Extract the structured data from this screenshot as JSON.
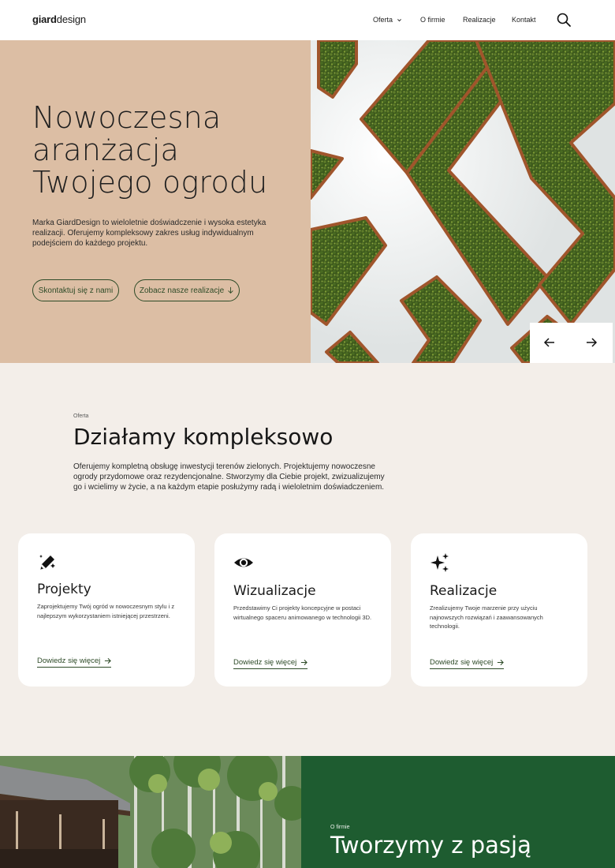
{
  "header": {
    "logo_bold": "giard",
    "logo_rest": "design",
    "nav": [
      "Oferta",
      "O firmie",
      "Realizacje",
      "Kontakt"
    ],
    "icons": {
      "dropdown": "chevron-down-icon",
      "search": "search-icon"
    }
  },
  "hero": {
    "title": "Nowoczesna aranżacja Twojego ogrodu",
    "text": "Marka GiardDesign to wieloletnie doświadczenie i wysoka estetyka realizacji. Oferujemy kompleksowy zakres usług indywidualnym podejściem do każdego projektu.",
    "btn_contact": "Skontaktuj się z nami",
    "btn_realizations": "Zobacz nasze realizacje",
    "image": "garden-maze-photo",
    "slider_icons": {
      "prev": "arrow-left-icon",
      "next": "arrow-right-icon"
    }
  },
  "offer": {
    "eyebrow": "Oferta",
    "title": "Działamy kompleksowo",
    "text": "Oferujemy kompletną obsługę inwestycji terenów zielonych. Projektujemy nowoczesne ogrody przydomowe oraz rezydencjonalne. Stworzymy dla Ciebie projekt, zwizualizujemy go i wcielimy w życie, a na każdym etapie posłużymy radą i wieloletnim doświadczeniem.",
    "cards": [
      {
        "icon": "pencil-sparkle-icon",
        "title": "Projekty",
        "text": "Zaprojektujemy Twój ogród w nowoczesnym stylu i z najlepszym wykorzystaniem istniejącej przestrzeni.",
        "link": "Dowiedz się więcej"
      },
      {
        "icon": "eye-icon",
        "title": "Wizualizacje",
        "text": "Przedstawimy Ci projekty koncepcyjne w postaci wirtualnego spaceru animowanego w technologii 3D.",
        "link": "Dowiedz się więcej"
      },
      {
        "icon": "sparkles-icon",
        "title": "Realizacje",
        "text": "Zrealizujemy Twoje marzenie przy użyciu najnowszych rozwiązań i zaawansowanych technologii.",
        "link": "Dowiedz się więcej"
      }
    ]
  },
  "about": {
    "eyebrow": "O firmie",
    "title": "Tworzymy z pasją",
    "image": "japanese-house-garden-photo"
  },
  "colors": {
    "hero_bg": "#dcbea4",
    "page_bg": "#f3eee9",
    "accent_green": "#2e4b28",
    "about_bg": "#1e5c30"
  }
}
